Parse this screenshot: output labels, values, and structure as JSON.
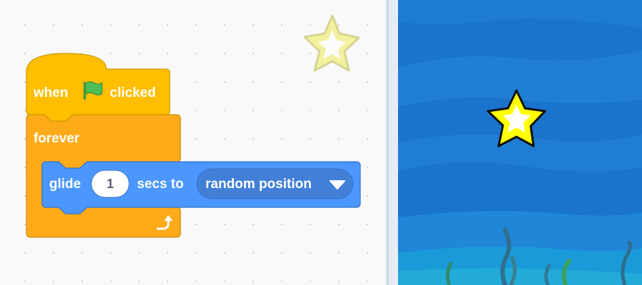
{
  "blocks": {
    "hat": {
      "prefix": "when",
      "flag_icon": "green-flag-icon",
      "suffix": "clicked"
    },
    "forever": {
      "label": "forever",
      "loop_icon": "loop-arrow-icon"
    },
    "glide": {
      "label": "glide",
      "secs": "1",
      "secs_to_label": "secs to",
      "target": "random position",
      "dropdown_icon": "dropdown-arrow-icon"
    }
  },
  "colors": {
    "events_block": "#ffbf00",
    "control_block": "#ffab19",
    "motion_block": "#4c97ff",
    "stage_background": "#1a73cc",
    "sprite_star": "#ffff00"
  }
}
